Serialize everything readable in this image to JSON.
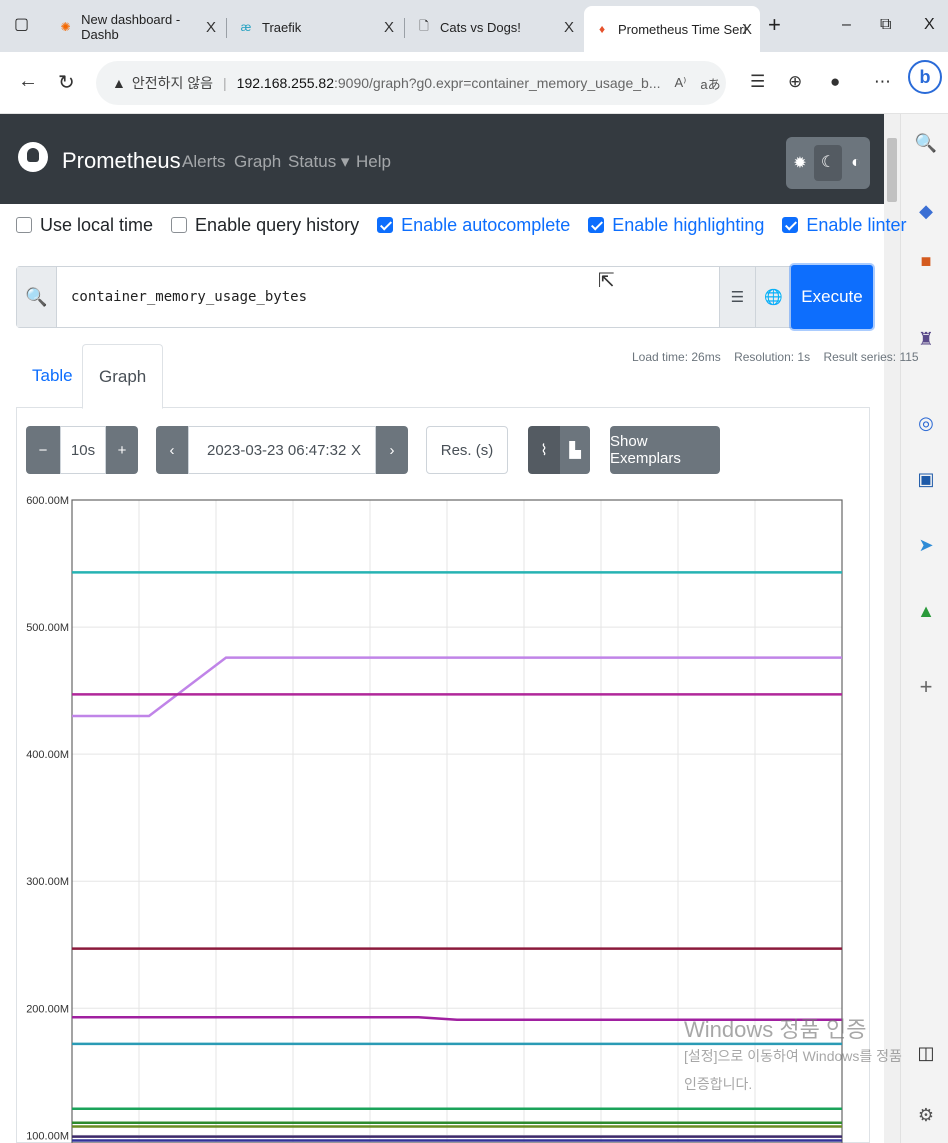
{
  "browser": {
    "tabs": [
      {
        "title": "New dashboard - Dashb",
        "icon": "grafana-icon"
      },
      {
        "title": "Traefik",
        "icon": "traefik-icon"
      },
      {
        "title": "Cats vs Dogs!",
        "icon": "page-icon"
      },
      {
        "title": "Prometheus Time Series",
        "icon": "prometheus-icon",
        "active": true
      }
    ],
    "address": {
      "security_label": "안전하지 않음",
      "host": "192.168.255.82",
      "path": ":9090/graph?g0.expr=container_memory_usage_b..."
    }
  },
  "navbar": {
    "brand": "Prometheus",
    "links": [
      "Alerts",
      "Graph",
      "Status",
      "Help"
    ]
  },
  "options": [
    {
      "label": "Use local time",
      "checked": false
    },
    {
      "label": "Enable query history",
      "checked": false
    },
    {
      "label": "Enable autocomplete",
      "checked": true
    },
    {
      "label": "Enable highlighting",
      "checked": true
    },
    {
      "label": "Enable linter",
      "checked": true
    }
  ],
  "query": {
    "expression": "container_memory_usage_bytes",
    "execute_label": "Execute"
  },
  "stats": {
    "load_time": "Load time: 26ms",
    "resolution": "Resolution: 1s",
    "result_series": "Result series: 115"
  },
  "view_tabs": {
    "table": "Table",
    "graph": "Graph"
  },
  "graph_controls": {
    "range": "10s",
    "minus": "−",
    "plus": "+",
    "end_time": "2023-03-23 06:47:32",
    "res_placeholder": "Res. (s)",
    "show_exemplars": "Show Exemplars"
  },
  "watermark": {
    "line1": "Windows 정품 인증",
    "line2": "[설정]으로 이동하여 Windows를 정품",
    "line3": "인증합니다."
  },
  "chart_data": {
    "type": "line",
    "y_ticks": [
      "600.00M",
      "500.00M",
      "400.00M",
      "300.00M",
      "200.00M",
      "100.00M"
    ],
    "ylim_M": [
      94,
      600
    ],
    "series": [
      {
        "color": "#26b3b3",
        "values": [
          543,
          543
        ]
      },
      {
        "color": "#c084e8",
        "points": [
          [
            0,
            430
          ],
          [
            0.1,
            430
          ],
          [
            0.2,
            476
          ],
          [
            1,
            476
          ]
        ]
      },
      {
        "color": "#b0279a",
        "values": [
          447,
          447
        ]
      },
      {
        "color": "#8b1a3c",
        "values": [
          247,
          247
        ]
      },
      {
        "color": "#a020a0",
        "points": [
          [
            0,
            193
          ],
          [
            0.45,
            193
          ],
          [
            0.5,
            191
          ],
          [
            1,
            191
          ]
        ]
      },
      {
        "color": "#2a9bb5",
        "values": [
          172,
          172
        ]
      },
      {
        "color": "#1aa35a",
        "values": [
          121,
          121
        ]
      },
      {
        "color": "#2e8b2e",
        "values": [
          110,
          110
        ]
      },
      {
        "color": "#6b8e23",
        "values": [
          107,
          107
        ]
      },
      {
        "color": "#3d2a6b",
        "values": [
          99,
          99
        ]
      },
      {
        "color": "#333399",
        "values": [
          96,
          96
        ]
      }
    ]
  }
}
